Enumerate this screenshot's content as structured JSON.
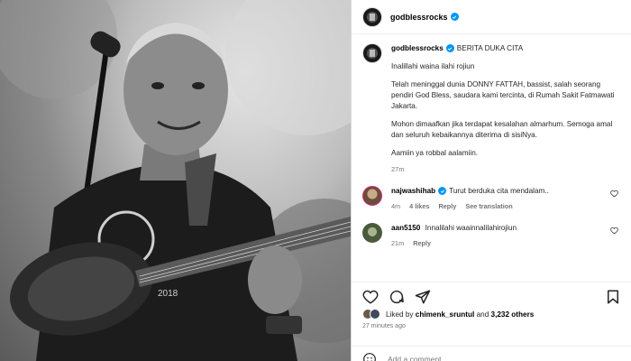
{
  "post": {
    "username": "godblessrocks",
    "caption_title": "BERITA DUKA CITA",
    "caption_paragraphs": [
      "Inalillahi waina ilahi rojiun",
      "Telah meninggal dunia DONNY FATTAH, bassist, salah seorang pendiri God Bless, saudara kami tercinta, di Rumah Sakit Fatmawati Jakarta.",
      "Mohon dimaafkan jika terdapat kesalahan almarhum. Semoga amal dan seluruh kebaikannya diterima di sisiNya.",
      "Aamiin ya robbal aalamiin."
    ],
    "caption_time": "27m",
    "likes_prefix": "Liked by",
    "likes_user": "chimenk_sruntul",
    "likes_and": "and",
    "likes_count": "3,232 others",
    "posted_ago": "27 minutes ago",
    "shirt_text": "2018"
  },
  "comments": [
    {
      "username": "najwashihab",
      "verified": true,
      "text": "Turut berduka cita mendalam..",
      "time": "4m",
      "likes": "4 likes",
      "reply": "Reply",
      "see_translation": "See translation",
      "avatar_color": "#6b4e3a"
    },
    {
      "username": "aan5150",
      "verified": false,
      "text": "Innalilahi waainnalilahirojiun",
      "time": "21m",
      "reply": "Reply",
      "avatar_color": "#4a5a3c"
    }
  ],
  "add_comment": {
    "placeholder": "Add a comment..."
  },
  "colors": {
    "verified": "#0095f6",
    "secondary_text": "#737373",
    "border": "#dbdbdb"
  },
  "icons": [
    "verified-badge-icon",
    "heart-icon",
    "comment-icon",
    "share-icon",
    "save-icon",
    "emoji-icon"
  ]
}
